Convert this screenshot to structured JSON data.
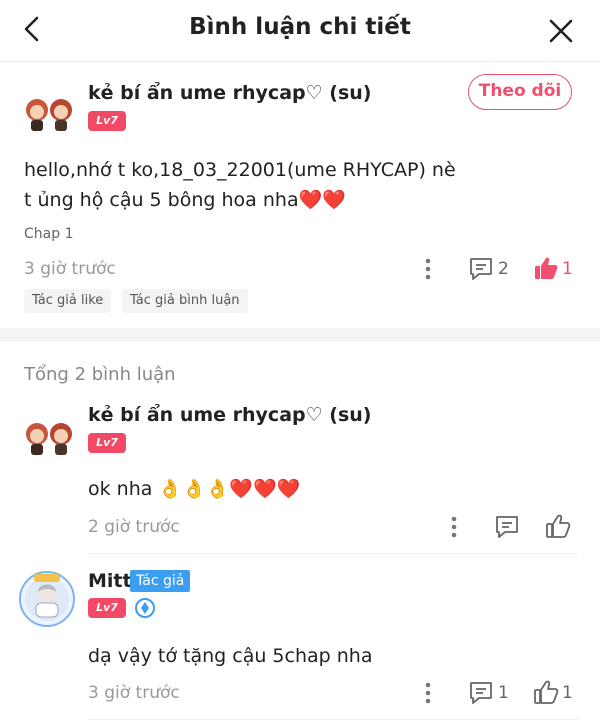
{
  "header": {
    "title": "Bình luận chi tiết",
    "back_icon": "back-arrow-icon",
    "close_icon": "close-icon"
  },
  "main_comment": {
    "username": "kẻ bí ẩn ume rhycap♡ (su)",
    "level": "Lv7",
    "follow_label": "Theo dõi",
    "text_line1": "hello,nhớ t ko,18_03_22001(ume RHYCAP) nè",
    "text_line2": "t ủng hộ cậu 5 bông hoa nha❤️❤️",
    "chapter": "Chap 1",
    "time": "3 giờ trước",
    "reply_count": "2",
    "like_count": "1",
    "tags": [
      "Tác giả like",
      "Tác giả bình luận"
    ]
  },
  "replies_header": {
    "total_label": "Tổng 2 bình luận"
  },
  "replies": [
    {
      "username": "kẻ bí ẩn ume rhycap♡ (su)",
      "level": "Lv7",
      "text": "ok nha 👌👌👌❤️❤️❤️",
      "time": "2 giờ trước"
    },
    {
      "username": "Mitt",
      "author_badge": "Tác giả",
      "level": "Lv7",
      "text": "dạ vậy tớ tặng cậu 5chap nha",
      "time": "3 giờ trước",
      "reply_count": "1",
      "like_count": "1"
    }
  ],
  "colors": {
    "accent_pink": "#f0506e",
    "level_badge": "#f24a66",
    "author_badge": "#3c9ef0"
  }
}
